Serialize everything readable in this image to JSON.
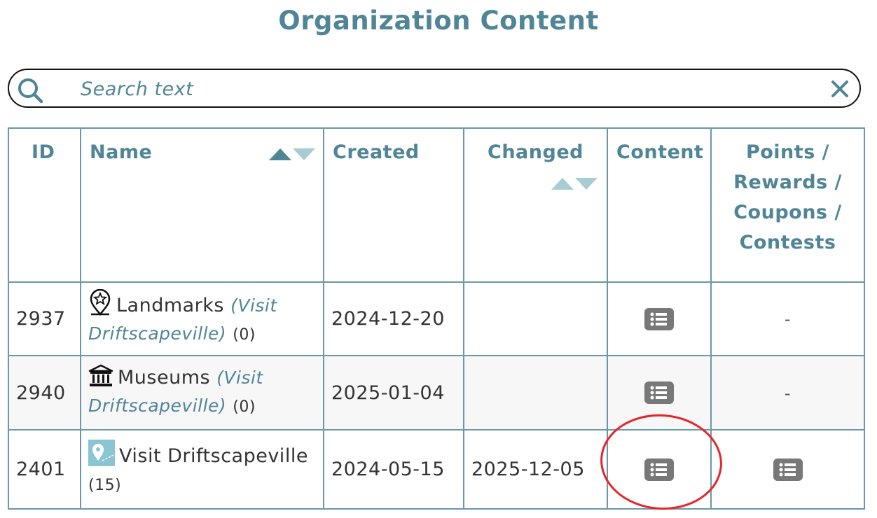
{
  "page": {
    "title": "Organization Content"
  },
  "search": {
    "placeholder": "Search text"
  },
  "table": {
    "headers": {
      "id": "ID",
      "name": "Name",
      "created": "Created",
      "changed": "Changed",
      "content": "Content",
      "points_lines": [
        "Points /",
        "Rewards /",
        "Coupons /",
        "Contests"
      ]
    },
    "sort": {
      "name": "ascending",
      "changed": "none"
    },
    "rows": [
      {
        "id": "2937",
        "icon": "landmark-pin-icon",
        "name": "Landmarks",
        "parent": "(Visit Driftscapeville)",
        "count": "(0)",
        "created": "2024-12-20",
        "changed": "",
        "points": "-"
      },
      {
        "id": "2940",
        "icon": "museum-icon",
        "name": "Museums",
        "parent": "(Visit Driftscapeville)",
        "count": "(0)",
        "created": "2025-01-04",
        "changed": "",
        "points": "-"
      },
      {
        "id": "2401",
        "icon": "map-pin-thumbnail-icon",
        "name": "Visit Driftscapeville",
        "parent": "",
        "count": "(15)",
        "created": "2024-05-15",
        "changed": "2025-12-05",
        "points": "list-icon"
      }
    ]
  },
  "colors": {
    "accent": "#4f8597",
    "border": "#6b98a8",
    "button_gray": "#787878",
    "highlight": "#e4262c"
  }
}
